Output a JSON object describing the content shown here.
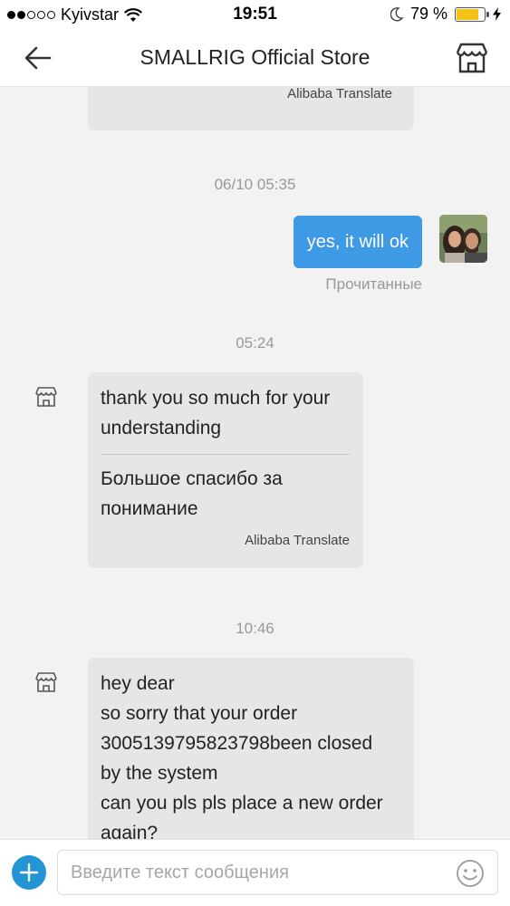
{
  "status_bar": {
    "carrier": "Kyivstar",
    "time": "19:51",
    "battery": "79 %",
    "battery_level": 0.79
  },
  "header": {
    "title": "SMALLRIG Official Store"
  },
  "messages": {
    "first_translate_tag": "Alibaba Translate",
    "timestamp_1": "06/10 05:35",
    "outgoing_text": "yes, it will ok",
    "read_status": "Прочитанные",
    "timestamp_2": "05:24",
    "in_1_original": "thank you so much for your understanding",
    "in_1_translation": "Большое спасибо за понимание",
    "in_1_translate_tag": "Alibaba Translate",
    "timestamp_3": "10:46",
    "in_2_lines": [
      "hey dear",
      "so sorry that your order",
      "3005139795823798been  closed",
      "by the system",
      "can you pls pls place a  new order",
      "again?"
    ]
  },
  "input": {
    "placeholder": "Введите текст сообщения",
    "value": ""
  },
  "icons": {
    "back": "back-arrow-icon",
    "store": "store-icon",
    "plus": "plus-icon",
    "emoji": "emoji-icon",
    "wifi": "wifi-icon",
    "moon": "moon-icon",
    "charging": "charging-icon"
  },
  "colors": {
    "outgoing_bubble": "#3f9ae6",
    "incoming_bubble": "#e6e6e6",
    "plus_button": "#2196d3",
    "battery_fill": "#f5c218"
  }
}
